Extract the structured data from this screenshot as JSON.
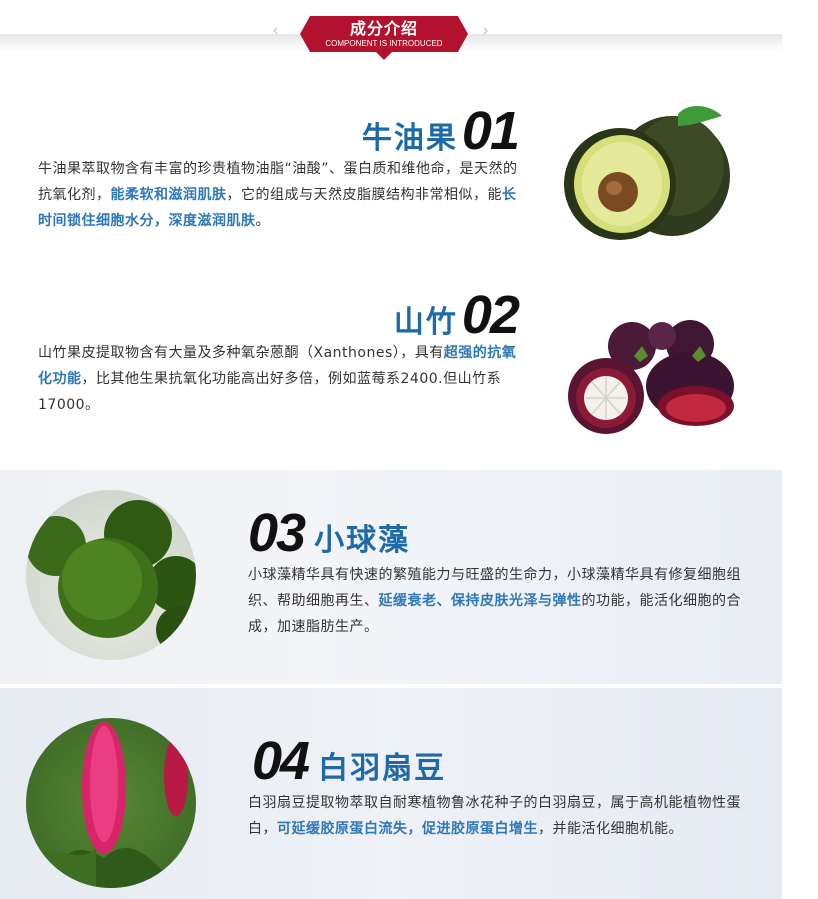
{
  "header": {
    "title": "成分介绍",
    "subtitle": "COMPONENT IS INTRODUCED"
  },
  "sections": [
    {
      "name": "牛油果",
      "number": "01",
      "text": [
        {
          "t": "牛油果萃取物含有丰富的珍贵植物油脂“油酸”、蛋白质和维他命，是天然的抗氧化剂，",
          "hl": false
        },
        {
          "t": "能柔软和滋润肌肤",
          "hl": true
        },
        {
          "t": "，它的组成与天然皮脂膜结构非常相似，能",
          "hl": false
        },
        {
          "t": "长时间锁住细胞水分，深度滋润肌肤",
          "hl": true
        },
        {
          "t": "。",
          "hl": false
        }
      ]
    },
    {
      "name": "山竹",
      "number": "02",
      "text": [
        {
          "t": "山竹果皮提取物含有大量及多种氧杂蒽酮（Xanthones），具有",
          "hl": false
        },
        {
          "t": "超强的抗氧化功能",
          "hl": true
        },
        {
          "t": "，比其他生果抗氧化功能高出好多倍，例如蓝莓系2400.但山竹系17000。",
          "hl": false
        }
      ]
    },
    {
      "name": "小球藻",
      "number": "03",
      "text": [
        {
          "t": "小球藻精华具有快速的繁殖能力与旺盛的生命力，小球藻精华具有修复细胞组织、帮助细胞再生、",
          "hl": false
        },
        {
          "t": "延缓衰老、保持皮肤光泽与弹性",
          "hl": true
        },
        {
          "t": "的功能，能活化细胞的合成，加速脂肪生产。",
          "hl": false
        }
      ]
    },
    {
      "name": "白羽扇豆",
      "number": "04",
      "text": [
        {
          "t": "白羽扇豆提取物萃取自耐寒植物鲁冰花种子的白羽扇豆，属于高机能植物性蛋白，",
          "hl": false
        },
        {
          "t": "可延缓胶原蛋白流失，促进胶原蛋白增生",
          "hl": true
        },
        {
          "t": "，并能活化细胞机能。",
          "hl": false
        }
      ]
    }
  ],
  "colors": {
    "accent": "#1e6aa8",
    "highlight": "#2f78b8",
    "banner": "#b3122f"
  }
}
